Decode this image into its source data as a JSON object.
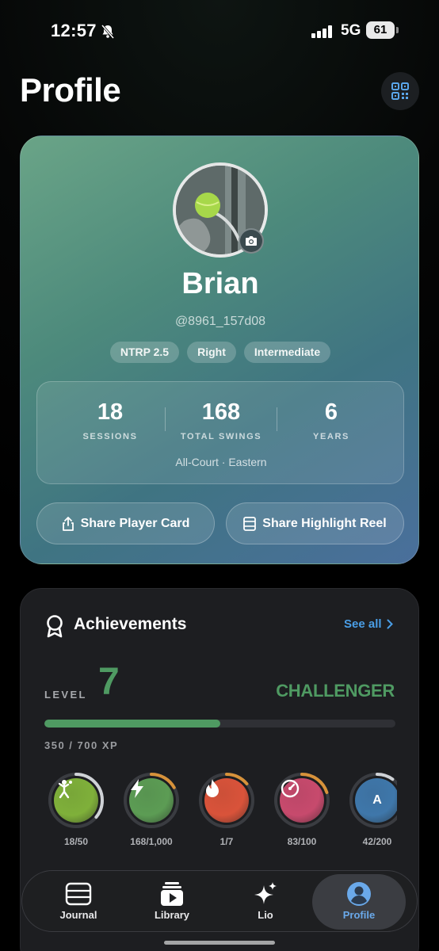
{
  "status_bar": {
    "time": "12:57",
    "network": "5G",
    "battery": "61"
  },
  "header": {
    "title": "Profile"
  },
  "profile": {
    "name": "Brian",
    "handle": "@8961_157d08",
    "tags": [
      "NTRP 2.5",
      "Right",
      "Intermediate"
    ],
    "stats": [
      {
        "value": "18",
        "label": "SESSIONS"
      },
      {
        "value": "168",
        "label": "TOTAL SWINGS"
      },
      {
        "value": "6",
        "label": "YEARS"
      }
    ],
    "style_line": "All-Court · Eastern",
    "share_player_label": "Share Player Card",
    "share_reel_label": "Share Highlight Reel"
  },
  "achievements": {
    "title": "Achievements",
    "see_all": "See all",
    "level_label": "LEVEL",
    "level": "7",
    "rank": "CHALLENGER",
    "xp_text": "350 / 700 XP",
    "xp_progress": 0.5,
    "badges": [
      {
        "count": "18/50",
        "progress": 0.36,
        "color": "#7fb03a",
        "ring": "#cfd2d6",
        "icon": "tennis-player-icon"
      },
      {
        "count": "168/1,000",
        "progress": 0.168,
        "color": "#5c9c54",
        "ring": "#d7923a",
        "icon": "lightning-icon"
      },
      {
        "count": "1/7",
        "progress": 0.14,
        "color": "#d9533a",
        "ring": "#d7923a",
        "icon": "flame-icon"
      },
      {
        "count": "83/100",
        "progress": 0.2,
        "color": "#c74a6d",
        "ring": "#d7923a",
        "icon": "speedometer-icon"
      },
      {
        "count": "42/200",
        "progress": 0.1,
        "color": "#3f77aa",
        "ring": "#cfd2d6",
        "icon": "letter-a-icon",
        "letter": "A"
      }
    ]
  },
  "tabbar": {
    "tabs": [
      {
        "label": "Journal",
        "icon": "journal-icon"
      },
      {
        "label": "Library",
        "icon": "library-icon"
      },
      {
        "label": "Lio",
        "icon": "sparkle-icon"
      },
      {
        "label": "Profile",
        "icon": "profile-icon",
        "active": true
      }
    ]
  },
  "colors": {
    "accent_green": "#4f9a62",
    "link_blue": "#4a9ee6",
    "active_tab": "#6aa9ea"
  }
}
